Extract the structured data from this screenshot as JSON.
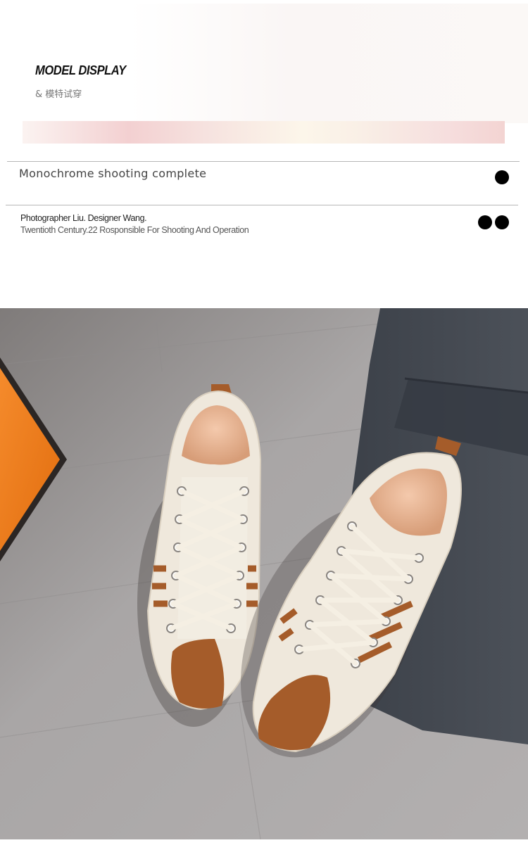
{
  "header": {
    "title": "MODEL DISPLAY",
    "subtitle": "& 模特试穿"
  },
  "section": {
    "heading": "Monochrome shooting complete"
  },
  "credits": {
    "line1": "Photographer Liu. Designer Wang.",
    "line2": "Twentioth Century.22 Rosponsible For Shooting And Operation"
  },
  "colors": {
    "accent_orange": "#f7801e",
    "shoe_brown": "#a55c2a",
    "shoe_cream": "#efe8dc",
    "floor_gray": "#9d9a9a",
    "cloth_dark": "#434851"
  },
  "photo": {
    "subject": "pair of cream sneakers with brown stripes and heel accents on a wooden floor, orange box and dark garment nearby"
  }
}
